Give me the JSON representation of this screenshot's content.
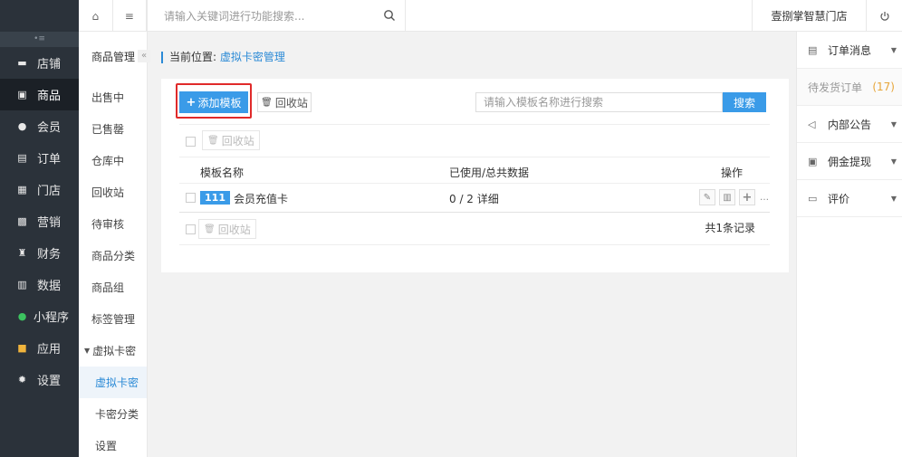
{
  "nav": {
    "items": [
      {
        "key": "store",
        "label": "店铺"
      },
      {
        "key": "goods",
        "label": "商品",
        "active": true
      },
      {
        "key": "member",
        "label": "会员"
      },
      {
        "key": "order",
        "label": "订单"
      },
      {
        "key": "shop",
        "label": "门店"
      },
      {
        "key": "marketing",
        "label": "营销"
      },
      {
        "key": "finance",
        "label": "财务"
      },
      {
        "key": "data",
        "label": "数据"
      },
      {
        "key": "miniapp",
        "label": "小程序"
      },
      {
        "key": "apps",
        "label": "应用"
      },
      {
        "key": "settings",
        "label": "设置"
      }
    ]
  },
  "subnav": {
    "title": "商品管理",
    "items": [
      "出售中",
      "已售罄",
      "仓库中",
      "回收站",
      "待审核",
      "商品分类",
      "商品组",
      "标签管理"
    ],
    "parent": "虚拟卡密",
    "children": [
      "虚拟卡密",
      "卡密分类",
      "设置"
    ]
  },
  "topbar": {
    "search_placeholder": "请输入关键词进行功能搜索...",
    "store_name": "壹捌掌智慧门店"
  },
  "breadcrumb": {
    "prefix": "当前位置:",
    "current": "虚拟卡密管理"
  },
  "panel": {
    "add_label": "添加模板",
    "recycle_label": "回收站",
    "search_placeholder": "请输入模板名称进行搜索",
    "search_button": "搜索",
    "batch_recycle": "回收站",
    "columns": {
      "name": "模板名称",
      "usage": "已使用/总共数据",
      "ops": "操作"
    },
    "rows": [
      {
        "badge": "111",
        "name": "会员充值卡",
        "usage": "0 / 2 详细"
      }
    ],
    "total": "共1条记录"
  },
  "right": {
    "order_msg": "订单消息",
    "pending_label": "待发货订单",
    "pending_count": "(17)",
    "notice": "内部公告",
    "commission": "佣金提现",
    "review": "评价"
  },
  "colors": {
    "accent": "#3a9be8",
    "sidebar": "#2b323a",
    "highlight": "#e02a2a"
  }
}
